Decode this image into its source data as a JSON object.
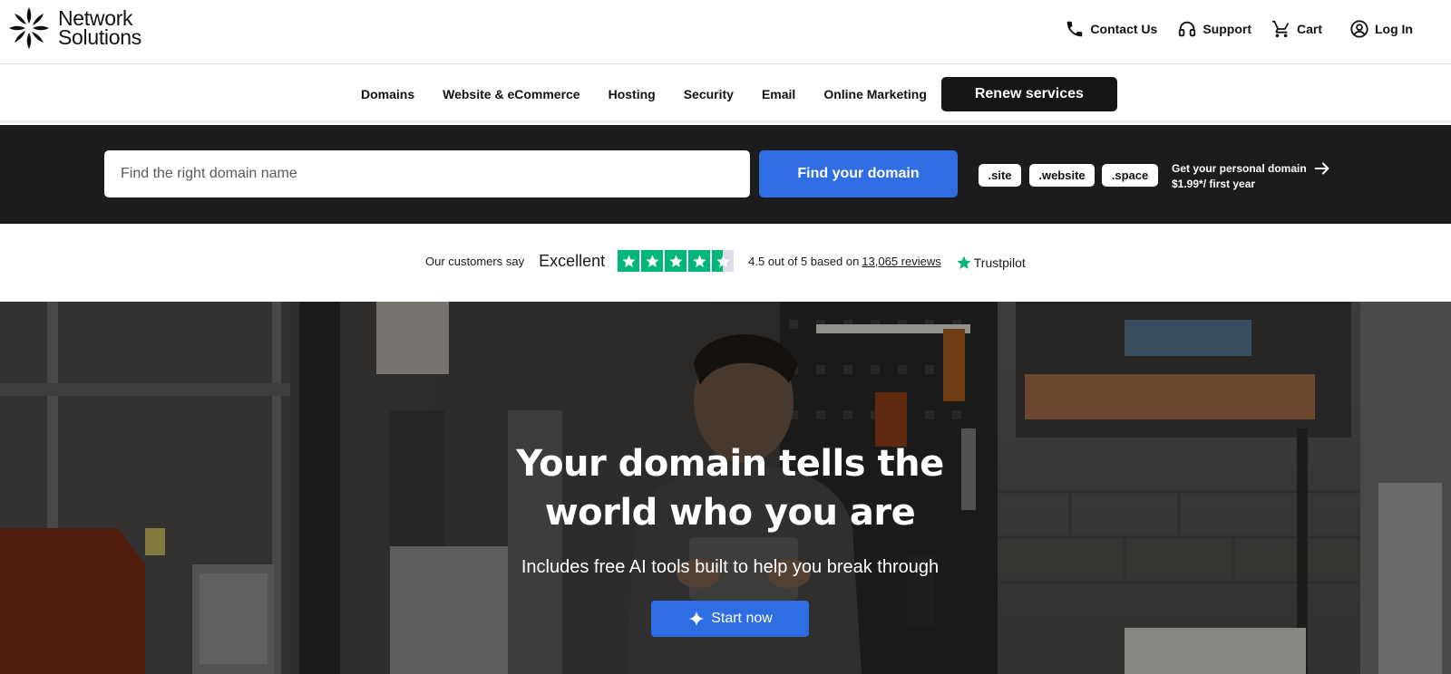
{
  "header": {
    "logo": {
      "line1": "Network",
      "line2": "Solutions"
    },
    "utility": {
      "contact": "Contact Us",
      "support": "Support",
      "cart": "Cart",
      "login": "Log In"
    }
  },
  "nav": {
    "items": [
      "Domains",
      "Website & eCommerce",
      "Hosting",
      "Security",
      "Email",
      "Online Marketing"
    ],
    "renew_label": "Renew services"
  },
  "search": {
    "placeholder": "Find the right domain name",
    "button_label": "Find your domain",
    "tlds": [
      ".site",
      ".website",
      ".space"
    ],
    "promo_line1": "Get your personal domain",
    "promo_line2": "$1.99*/ first year"
  },
  "trustpilot": {
    "say": "Our customers say",
    "rating_word": "Excellent",
    "rating": 4.5,
    "score_text": "4.5 out of 5 based on",
    "reviews_link": "13,065 reviews",
    "brand": "Trustpilot",
    "brand_color": "#00b67a"
  },
  "hero": {
    "title_line1": "Your domain tells the",
    "title_line2": "world who you are",
    "subtitle": "Includes free AI tools built to help you break through",
    "cta_label": "Start now",
    "cta_icon": "sparkle-icon"
  },
  "colors": {
    "accent_blue": "#2f6de3",
    "band_dark": "#1c1c1c",
    "renew_black": "#161616"
  }
}
